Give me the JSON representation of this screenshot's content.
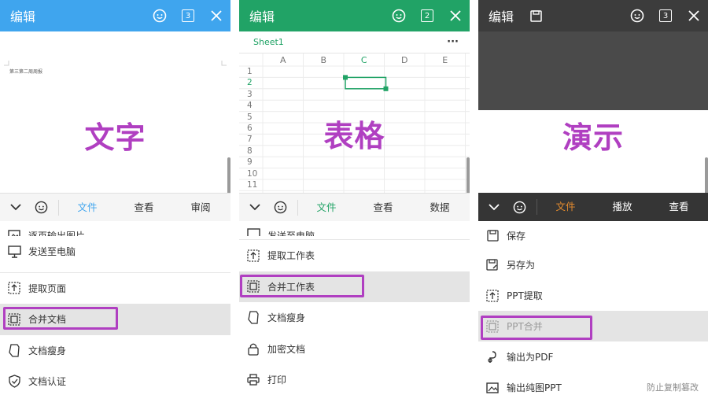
{
  "panels": [
    {
      "id": "writer",
      "header": {
        "title": "编辑",
        "count": "3",
        "color": "#3fa5ee"
      },
      "doc_text": "第三第二周周报",
      "label": "文字",
      "tabs": {
        "active": "文件",
        "items": [
          "文件",
          "查看",
          "审阅"
        ],
        "accent": "#3fa5ee"
      },
      "partial_item": "逐页输出图片",
      "items": [
        "发送至电脑",
        "提取页面",
        "合并文档",
        "文档瘦身",
        "文档认证"
      ],
      "icons": [
        "image-icon",
        "monitor-icon",
        "extract-icon",
        "merge-icon",
        "slim-icon",
        "shield-check-icon"
      ]
    },
    {
      "id": "sheets",
      "header": {
        "title": "编辑",
        "count": "2",
        "color": "#21a366"
      },
      "sheet_tab": "Sheet1",
      "more": "···",
      "columns": [
        "A",
        "B",
        "C",
        "D",
        "E"
      ],
      "rows": [
        "1",
        "2",
        "3",
        "4",
        "5",
        "6",
        "7",
        "8",
        "9",
        "10",
        "11"
      ],
      "label": "表格",
      "tabs": {
        "active": "文件",
        "items": [
          "文件",
          "查看",
          "数据"
        ],
        "accent": "#21a366"
      },
      "partial_item": "发送至电脑",
      "items": [
        "提取工作表",
        "合并工作表",
        "文档瘦身",
        "加密文档",
        "打印"
      ],
      "icons": [
        "monitor-icon",
        "extract-icon",
        "merge-icon",
        "slim-icon",
        "lock-icon",
        "printer-icon"
      ]
    },
    {
      "id": "slides",
      "header": {
        "title": "编辑",
        "count": "3",
        "color": "#3c3c3c"
      },
      "label": "演示",
      "tabs": {
        "active": "文件",
        "items": [
          "文件",
          "播放",
          "查看"
        ],
        "accent": "#e58c2e"
      },
      "items": [
        "保存",
        "另存为",
        "PPT提取",
        "PPT合并",
        "输出为PDF",
        "输出纯图PPT"
      ],
      "icons": [
        "save-icon",
        "save-as-icon",
        "extract-icon",
        "merge-icon",
        "pdf-icon",
        "image-icon"
      ],
      "watermark": "防止复制篡改"
    }
  ]
}
